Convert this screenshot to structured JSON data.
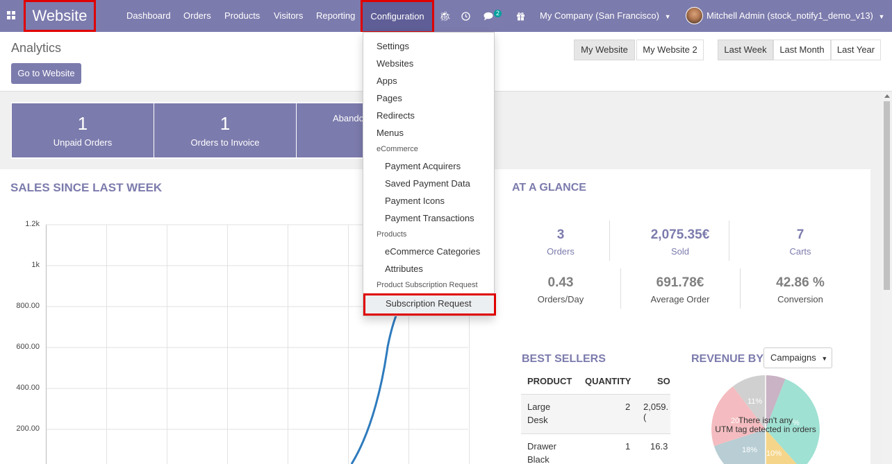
{
  "topbar": {
    "brand": "Website",
    "menu": [
      "Dashboard",
      "Orders",
      "Products",
      "Visitors",
      "Reporting"
    ],
    "configuration": "Configuration",
    "messages_count": "2",
    "company": "My Company (San Francisco)",
    "user": "Mitchell Admin (stock_notify1_demo_v13)",
    "accent": "#7c7bad"
  },
  "control_panel": {
    "title": "Analytics",
    "go_to_website": "Go to Website",
    "websites": [
      "My Website",
      "My Website 2"
    ],
    "periods": [
      "Last Week",
      "Last Month",
      "Last Year"
    ]
  },
  "tiles": [
    {
      "value": "1",
      "label": "Unpaid Orders"
    },
    {
      "value": "1",
      "label": "Orders to Invoice"
    },
    {
      "value": "",
      "label": "Abando"
    }
  ],
  "sales": {
    "title": "SALES SINCE LAST WEEK"
  },
  "chart_data": {
    "type": "line",
    "yticks": [
      "1.2k",
      "1k",
      "800.00",
      "600.00",
      "400.00",
      "200.00"
    ],
    "ylim": [
      0,
      1200
    ],
    "grid": true,
    "color": "#2e7bbd"
  },
  "dropdown": {
    "items": [
      "Settings",
      "Websites",
      "Apps",
      "Pages",
      "Redirects",
      "Menus"
    ],
    "ecommerce_header": "eCommerce",
    "ecommerce_items": [
      "Payment Acquirers",
      "Saved Payment Data",
      "Payment Icons",
      "Payment Transactions"
    ],
    "products_header": "Products",
    "products_items": [
      "eCommerce Categories",
      "Attributes"
    ],
    "subscription_header": "Product Subscription Request",
    "subscription_item": "Subscription Request"
  },
  "glance": {
    "title": "AT A GLANCE",
    "row1": [
      {
        "value": "3",
        "label": "Orders"
      },
      {
        "value": "2,075.35€",
        "label": "Sold"
      },
      {
        "value": "7",
        "label": "Carts"
      }
    ],
    "row2": [
      {
        "value": "0.43",
        "label": "Orders/Day"
      },
      {
        "value": "691.78€",
        "label": "Average Order"
      },
      {
        "value": "42.86 %",
        "label": "Conversion"
      }
    ]
  },
  "best_sellers": {
    "title": "BEST SELLERS",
    "columns": [
      "PRODUCT",
      "QUANTITY",
      "SO"
    ],
    "rows": [
      {
        "product_1": "Large",
        "product_2": "Desk",
        "qty": "2",
        "sold": "2,059.("
      },
      {
        "product_1": "Drawer",
        "product_2": "Black",
        "qty": "1",
        "sold": "16.3"
      }
    ]
  },
  "revenue": {
    "title": "REVENUE BY",
    "select": "Campaigns",
    "empty_1": "There isn't any",
    "empty_2": "UTM tag detected in orders",
    "slice_labels": [
      "11%",
      "20",
      "18%",
      "10%",
      "%"
    ]
  }
}
